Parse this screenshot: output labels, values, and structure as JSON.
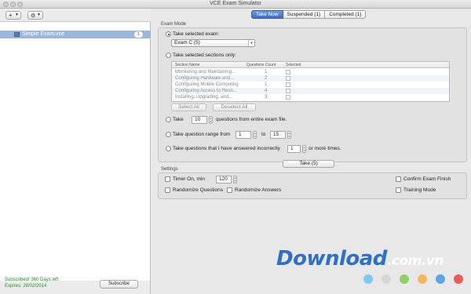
{
  "window": {
    "title": "VCE Exam Simulator"
  },
  "toolbar": {
    "add_label": "+",
    "gear_label": "⚙"
  },
  "sidebar": {
    "exam": {
      "name": "Simple Exam.vce",
      "count": "1"
    }
  },
  "subscription": {
    "status": "Subscribed! 360 Days left",
    "expires": "Expires: 28/02/2014",
    "subscribe_label": "Subscribe"
  },
  "tabs": [
    {
      "label": "Take Now"
    },
    {
      "label": "Suspended (1)"
    },
    {
      "label": "Completed (1)"
    }
  ],
  "exam_mode": {
    "group_label": "Exam Mode",
    "take_selected_label": "Take selected exam:",
    "exam_select_value": "Exam C (5)",
    "take_sections_label": "Take selected sections only:",
    "table": {
      "headers": [
        "Section Name",
        "Questions Count",
        "Selected"
      ],
      "rows": [
        {
          "name": "Monitoring and Maintaining...",
          "count": "1"
        },
        {
          "name": "Configuring Hardware and...",
          "count": "2"
        },
        {
          "name": "Configuring Mobile Computing",
          "count": "1"
        },
        {
          "name": "Configuring Access to Reso...",
          "count": "4"
        },
        {
          "name": "Installing, Upgrading, and...",
          "count": "3"
        }
      ]
    },
    "select_all_label": "Select All",
    "deselect_all_label": "Deselect All",
    "take_count_label": "Take",
    "take_count_value": "10",
    "take_count_suffix": "questions from entire exam file.",
    "range_label": "Take question range from",
    "range_from": "1",
    "range_to_label": "to",
    "range_to": "15",
    "incorrect_label": "Take questions that I have answered incorrectly",
    "incorrect_value": "1",
    "incorrect_suffix": "or more times."
  },
  "take_button_label": "Take (5)",
  "settings": {
    "group_label": "Settings",
    "timer_label": "Timer On, min",
    "timer_value": "120",
    "confirm_finish_label": "Confirm Exam Finish",
    "randomize_questions_label": "Randomize Questions",
    "randomize_answers_label": "Randomize Answers",
    "training_mode_label": "Training Mode"
  },
  "watermark": {
    "main": "Download",
    "suffix": ".com.vn"
  },
  "watermark_dots": [
    "#7fc8ef",
    "#d7d7d7",
    "#8fd06a",
    "#f4b860",
    "#5da6e6",
    "#e85c5c"
  ]
}
